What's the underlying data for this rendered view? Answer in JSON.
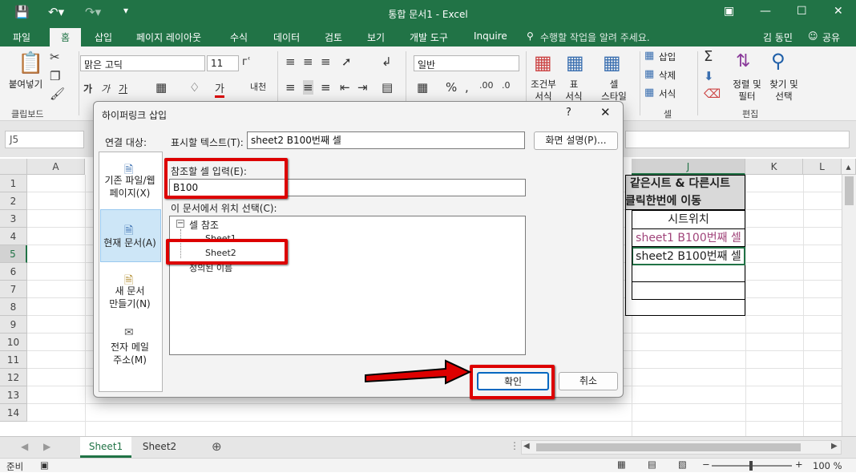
{
  "titlebar": {
    "title": "통합 문서1 - Excel"
  },
  "tabs": [
    "파일",
    "홈",
    "삽입",
    "페이지 레이아웃",
    "수식",
    "데이터",
    "검토",
    "보기",
    "개발 도구",
    "Inquire"
  ],
  "tellme": "수행할 작업을 알려 주세요.",
  "user": "김 동민",
  "share": "공유",
  "ribbon": {
    "paste": "붙여넣기",
    "clipboard": "클립보드",
    "font_name": "맑은 고딕",
    "font_size": "11",
    "number_format": "일반",
    "cond_format": "조건부\n서식",
    "table_format": "표\n서식",
    "cell_style": "셀\n스타일",
    "insert": "삽입",
    "delete": "삭제",
    "format": "서식",
    "cells": "셀",
    "sort": "정렬 및\n필터",
    "find": "찾기 및\n선택",
    "edit": "편집"
  },
  "namebox": "J5",
  "columns": {
    "A": "A",
    "J": "J",
    "K": "K",
    "L": "L"
  },
  "rows": [
    "1",
    "2",
    "3",
    "4",
    "5",
    "6",
    "7",
    "8",
    "9",
    "10",
    "11",
    "12",
    "13",
    "14"
  ],
  "cells": {
    "j1": "같은시트 & 다른시트",
    "j2": "클릭한번에 이동",
    "j3": "시트위치",
    "j4": "sheet1 B100번째 셀",
    "j5": "sheet2 B100번째 셀"
  },
  "sheets": [
    "Sheet1",
    "Sheet2"
  ],
  "status": {
    "ready": "준비",
    "zoom": "100 %"
  },
  "dialog": {
    "title": "하이퍼링크 삽입",
    "help": "?",
    "link_to": "연결 대상:",
    "display_text_label": "표시할 텍스트(T):",
    "display_text_value": "sheet2 B100번째 셀",
    "screentip": "화면 설명(P)...",
    "cell_ref_label": "참조할 셀 입력(E):",
    "cell_ref_value": "B100",
    "place_label": "이 문서에서 위치 선택(C):",
    "tree_root": "셀 참조",
    "tree_sheet1": "Sheet1",
    "tree_sheet2": "Sheet2",
    "tree_names": "정의된 이름",
    "types": [
      {
        "label": "기존 파일/웹\n페이지(X)"
      },
      {
        "label": "현재 문서(A)"
      },
      {
        "label": "새 문서\n만들기(N)"
      },
      {
        "label": "전자 메일\n주소(M)"
      }
    ],
    "ok": "확인",
    "cancel": "취소"
  },
  "colors": {
    "excel_green": "#217346",
    "highlight": "#d00000",
    "selection": "#217346",
    "link_text": "#a0447a"
  }
}
